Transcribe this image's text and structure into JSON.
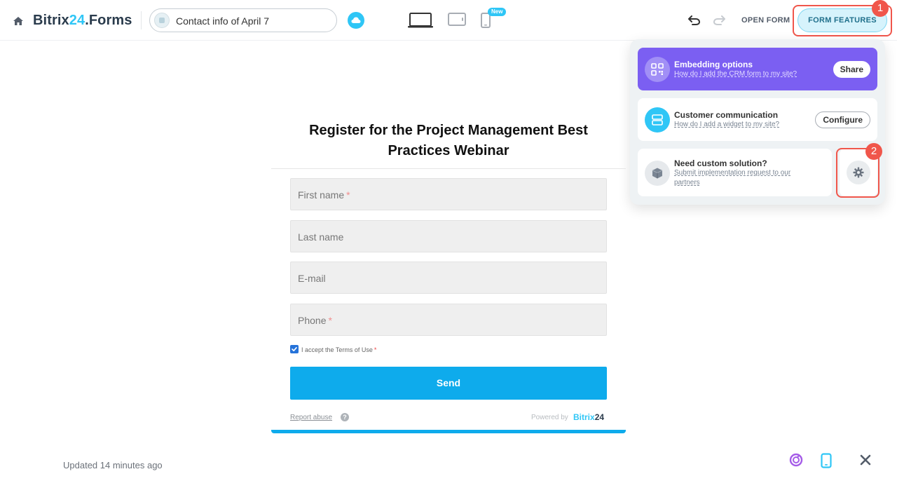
{
  "header": {
    "brand_main": "Bitrix",
    "brand_accent": "24",
    "brand_suffix": ".Forms",
    "form_name": "Contact info of April 7",
    "new_badge": "New",
    "open_form_label": "OPEN FORM",
    "form_features_label": "FORM FEATURES",
    "accent_color": "#2fc6f6",
    "highlight_color": "#f0564b"
  },
  "markers": [
    "1",
    "2"
  ],
  "features": {
    "embedding": {
      "title": "Embedding options",
      "link": "How do I add the CRM form to my site?",
      "button": "Share"
    },
    "communication": {
      "title": "Customer communication",
      "link": "How do I add a widget to my site?",
      "button": "Configure"
    },
    "custom": {
      "title": "Need custom solution?",
      "link": "Submit implementation request to our partners"
    }
  },
  "form": {
    "title": "Register for the Project Management Best Practices Webinar",
    "fields": [
      {
        "placeholder": "First name",
        "required": "*"
      },
      {
        "placeholder": "Last name",
        "required": ""
      },
      {
        "placeholder": "E-mail",
        "required": ""
      },
      {
        "placeholder": "Phone",
        "required": "*"
      }
    ],
    "terms_label": "I accept the Terms of Use",
    "terms_required": "*",
    "terms_checked": true,
    "send_label": "Send",
    "report_label": "Report abuse",
    "help_glyph": "?",
    "powered_label": "Powered by",
    "powered_brand": "Bitrix",
    "powered_brand_num": "24"
  },
  "footer": {
    "updated": "Updated 14 minutes ago"
  },
  "icons": [
    "home-icon",
    "cloud-icon",
    "laptop-icon",
    "tablet-icon",
    "phone-icon",
    "undo-icon",
    "redo-icon",
    "qr-icon",
    "chat-icon",
    "box-icon",
    "gear-icon",
    "check-icon",
    "help-icon",
    "assistant-icon",
    "mobile-preview-icon",
    "close-icon"
  ]
}
